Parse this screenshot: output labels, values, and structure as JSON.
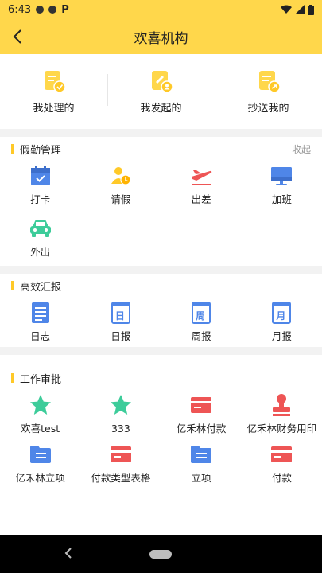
{
  "status": {
    "time": "6:43"
  },
  "appbar": {
    "title": "欢喜机构"
  },
  "quick": [
    {
      "label": "我处理的",
      "icon": "doc-check-icon"
    },
    {
      "label": "我发起的",
      "icon": "doc-edit-icon"
    },
    {
      "label": "抄送我的",
      "icon": "doc-cc-icon"
    }
  ],
  "attendance": {
    "title": "假勤管理",
    "collapse": "收起",
    "items": [
      {
        "label": "打卡",
        "icon": "calendar-icon"
      },
      {
        "label": "请假",
        "icon": "person-clock-icon"
      },
      {
        "label": "出差",
        "icon": "airplane-icon"
      },
      {
        "label": "加班",
        "icon": "monitor-icon"
      },
      {
        "label": "外出",
        "icon": "car-icon"
      }
    ]
  },
  "report": {
    "title": "高效汇报",
    "items": [
      {
        "label": "日志",
        "icon": "log-icon"
      },
      {
        "label": "日报",
        "icon": "daily-icon",
        "glyph": "日"
      },
      {
        "label": "周报",
        "icon": "weekly-icon",
        "glyph": "周"
      },
      {
        "label": "月报",
        "icon": "monthly-icon",
        "glyph": "月"
      }
    ]
  },
  "approval": {
    "title": "工作审批",
    "items": [
      {
        "label": "欢喜test",
        "icon": "star-icon"
      },
      {
        "label": "333",
        "icon": "star-icon"
      },
      {
        "label": "亿禾林付款",
        "icon": "card-icon"
      },
      {
        "label": "亿禾林财务用印",
        "icon": "stamp-icon"
      },
      {
        "label": "亿禾林立项",
        "icon": "folder-icon"
      },
      {
        "label": "付款类型表格",
        "icon": "card-icon"
      },
      {
        "label": "立项",
        "icon": "folder-icon"
      },
      {
        "label": "付款",
        "icon": "card-icon"
      }
    ]
  },
  "colors": {
    "yellow": "#ffd74b",
    "blue": "#4f86e8",
    "green": "#3dcc9a",
    "red": "#ee5555"
  }
}
